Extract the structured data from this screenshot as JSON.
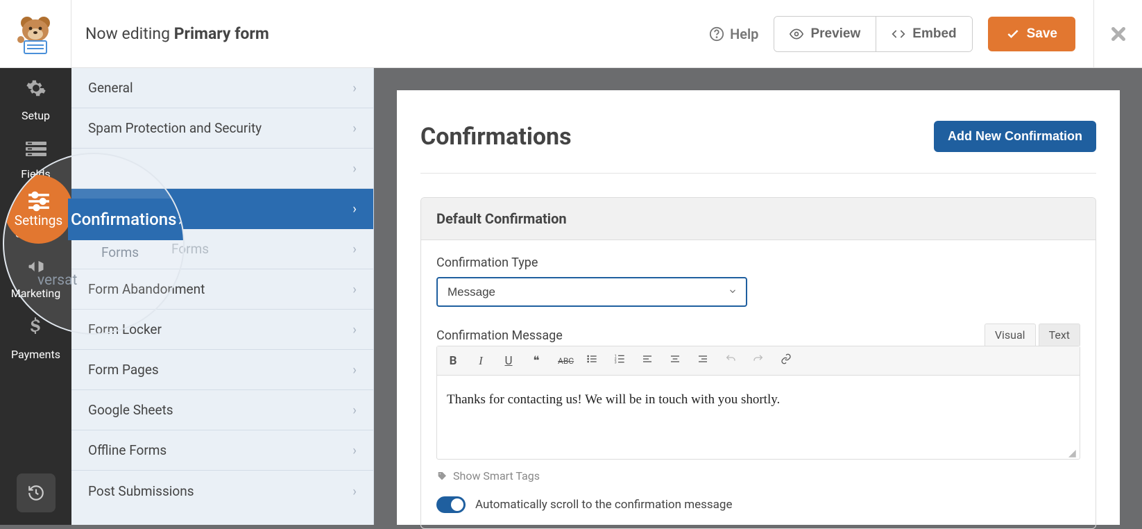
{
  "header": {
    "editing_prefix": "Now editing ",
    "form_name": "Primary form",
    "help": "Help",
    "preview": "Preview",
    "embed": "Embed",
    "save": "Save"
  },
  "admin_sidebar": {
    "items": [
      {
        "label": "Setup",
        "icon": "gear"
      },
      {
        "label": "Fields",
        "icon": "list"
      },
      {
        "label": "Settings",
        "icon": "sliders",
        "active": true
      },
      {
        "label": "Marketing",
        "icon": "megaphone"
      },
      {
        "label": "Payments",
        "icon": "dollar"
      }
    ]
  },
  "settings_sidebar": {
    "items": [
      {
        "label": "General"
      },
      {
        "label": "Spam Protection and Security"
      },
      {
        "label": ""
      },
      {
        "label": "Confirmations",
        "active": true
      },
      {
        "label": "Forms",
        "indent": true,
        "faded": true,
        "partial_suffix": " Forms"
      },
      {
        "label": "Form Abandonment"
      },
      {
        "label": "Form Locker"
      },
      {
        "label": "Form Pages"
      },
      {
        "label": "Google Sheets"
      },
      {
        "label": "Offline Forms"
      },
      {
        "label": "Post Submissions"
      }
    ]
  },
  "highlight": {
    "settings_label": "Settings",
    "confirmations": "Confirmations",
    "forms_fragment": "Forms",
    "versa_fragment": "versat"
  },
  "main": {
    "title": "Confirmations",
    "add_button": "Add New Confirmation",
    "box_title": "Default Confirmation",
    "type_label": "Confirmation Type",
    "type_value": "Message",
    "message_label": "Confirmation Message",
    "editor_tabs": {
      "visual": "Visual",
      "text": "Text"
    },
    "message_body": "Thanks for contacting us! We will be in touch with you shortly.",
    "smart_tags": "Show Smart Tags",
    "toggle_label": "Automatically scroll to the confirmation message"
  }
}
